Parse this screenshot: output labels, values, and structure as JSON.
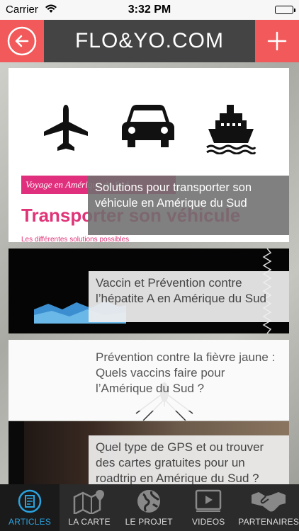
{
  "status_bar": {
    "carrier": "Carrier",
    "time": "3:32 PM"
  },
  "header": {
    "title": "FLO&YO.COM",
    "back_icon": "back-arrow-icon",
    "add_icon": "plus-icon"
  },
  "colors": {
    "accent": "#f2595a",
    "header_bg": "#444444",
    "tab_active": "#2aa3e0",
    "pink": "#e0307d"
  },
  "articles": [
    {
      "title": "Solutions pour transporter son véhicule en Amérique du Sud",
      "image": {
        "tag": "Voyage en Amérique du Sud",
        "headline": "Transporter son véhicule",
        "subline": "Les différentes solutions possibles",
        "icons": [
          "airplane-icon",
          "car-icon",
          "ship-icon"
        ]
      }
    },
    {
      "title": "Vaccin et Prévention contre l’hépatite A en Amérique du Sud"
    },
    {
      "title": "Prévention contre la fièvre jaune : Quels vaccins faire pour l’Amérique du Sud ?"
    },
    {
      "title": "Quel type de GPS et ou trouver des cartes gratuites pour un roadtrip en Amérique du Sud ?"
    }
  ],
  "tabs": [
    {
      "label": "ARTICLES",
      "icon": "articles-icon",
      "active": true
    },
    {
      "label": "LA CARTE",
      "icon": "map-icon",
      "active": false
    },
    {
      "label": "LE PROJET",
      "icon": "globe-icon",
      "active": false
    },
    {
      "label": "VIDEOS",
      "icon": "video-icon",
      "active": false
    },
    {
      "label": "PARTENAIRES",
      "icon": "handshake-icon",
      "active": false
    }
  ]
}
